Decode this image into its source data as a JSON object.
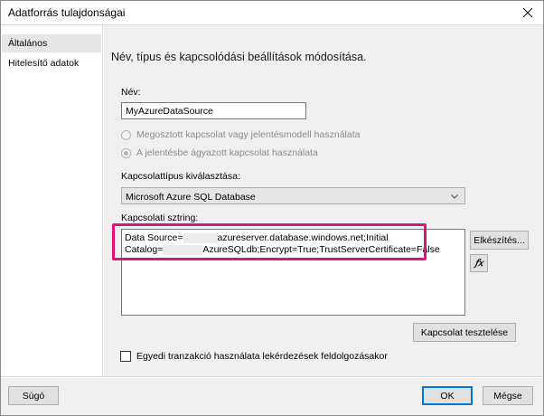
{
  "window": {
    "title": "Adatforrás tulajdonságai",
    "close_label": "×"
  },
  "sidebar": {
    "items": [
      {
        "label": "Általános",
        "selected": true
      },
      {
        "label": "Hitelesítő adatok",
        "selected": false
      }
    ]
  },
  "main": {
    "heading": "Név, típus és kapcsolódási beállítások módosítása.",
    "name_label": "Név:",
    "name_value": "MyAzureDataSource",
    "radio_shared": "Megosztott kapcsolat vagy jelentésmodell használata",
    "radio_embedded": "A jelentésbe ágyazott kapcsolat használata",
    "conn_type_label": "Kapcsolattípus kiválasztása:",
    "conn_type_value": "Microsoft Azure SQL Database",
    "conn_string_label": "Kapcsolati sztring:",
    "conn_string_line1_a": "Data Source=",
    "conn_string_line1_b": "azureserver.database.windows.net;Initial",
    "conn_string_line2_a": "Catalog=",
    "conn_string_line2_b": "AzureSQLdb;Encrypt=True;TrustServerCertificate=False",
    "build_button": "Elkészítés...",
    "fx_button_glyph": "𝑓𝑥",
    "test_button": "Kapcsolat tesztelése",
    "checkbox_label": "Egyedi tranzakció használata lekérdezések feldolgozásakor"
  },
  "footer": {
    "help_button": "Súgó",
    "ok_button": "OK",
    "cancel_button": "Mégse"
  },
  "colors": {
    "highlight": "#e4117a",
    "default_button_border": "#0078d7"
  }
}
